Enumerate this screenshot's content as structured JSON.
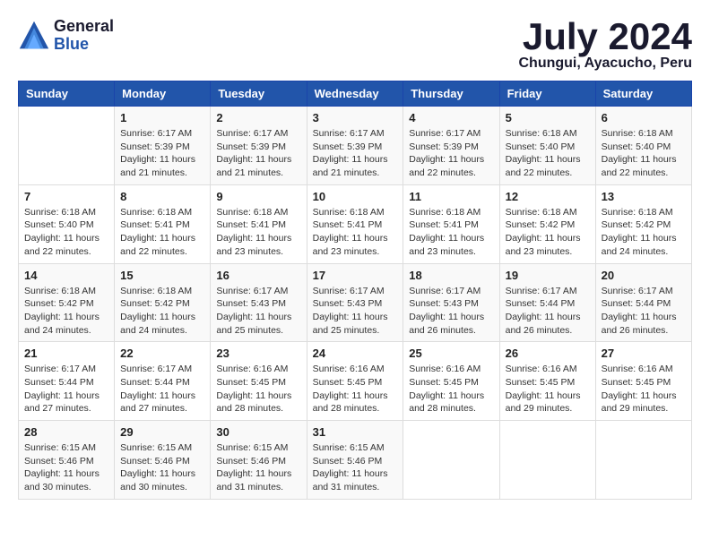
{
  "logo": {
    "general": "General",
    "blue": "Blue"
  },
  "title": {
    "month": "July 2024",
    "location": "Chungui, Ayacucho, Peru"
  },
  "headers": [
    "Sunday",
    "Monday",
    "Tuesday",
    "Wednesday",
    "Thursday",
    "Friday",
    "Saturday"
  ],
  "weeks": [
    [
      {
        "day": "",
        "sunrise": "",
        "sunset": "",
        "daylight": ""
      },
      {
        "day": "1",
        "sunrise": "6:17 AM",
        "sunset": "5:39 PM",
        "daylight": "11 hours and 21 minutes."
      },
      {
        "day": "2",
        "sunrise": "6:17 AM",
        "sunset": "5:39 PM",
        "daylight": "11 hours and 21 minutes."
      },
      {
        "day": "3",
        "sunrise": "6:17 AM",
        "sunset": "5:39 PM",
        "daylight": "11 hours and 21 minutes."
      },
      {
        "day": "4",
        "sunrise": "6:17 AM",
        "sunset": "5:39 PM",
        "daylight": "11 hours and 22 minutes."
      },
      {
        "day": "5",
        "sunrise": "6:18 AM",
        "sunset": "5:40 PM",
        "daylight": "11 hours and 22 minutes."
      },
      {
        "day": "6",
        "sunrise": "6:18 AM",
        "sunset": "5:40 PM",
        "daylight": "11 hours and 22 minutes."
      }
    ],
    [
      {
        "day": "7",
        "sunrise": "6:18 AM",
        "sunset": "5:40 PM",
        "daylight": "11 hours and 22 minutes."
      },
      {
        "day": "8",
        "sunrise": "6:18 AM",
        "sunset": "5:41 PM",
        "daylight": "11 hours and 22 minutes."
      },
      {
        "day": "9",
        "sunrise": "6:18 AM",
        "sunset": "5:41 PM",
        "daylight": "11 hours and 23 minutes."
      },
      {
        "day": "10",
        "sunrise": "6:18 AM",
        "sunset": "5:41 PM",
        "daylight": "11 hours and 23 minutes."
      },
      {
        "day": "11",
        "sunrise": "6:18 AM",
        "sunset": "5:41 PM",
        "daylight": "11 hours and 23 minutes."
      },
      {
        "day": "12",
        "sunrise": "6:18 AM",
        "sunset": "5:42 PM",
        "daylight": "11 hours and 23 minutes."
      },
      {
        "day": "13",
        "sunrise": "6:18 AM",
        "sunset": "5:42 PM",
        "daylight": "11 hours and 24 minutes."
      }
    ],
    [
      {
        "day": "14",
        "sunrise": "6:18 AM",
        "sunset": "5:42 PM",
        "daylight": "11 hours and 24 minutes."
      },
      {
        "day": "15",
        "sunrise": "6:18 AM",
        "sunset": "5:42 PM",
        "daylight": "11 hours and 24 minutes."
      },
      {
        "day": "16",
        "sunrise": "6:17 AM",
        "sunset": "5:43 PM",
        "daylight": "11 hours and 25 minutes."
      },
      {
        "day": "17",
        "sunrise": "6:17 AM",
        "sunset": "5:43 PM",
        "daylight": "11 hours and 25 minutes."
      },
      {
        "day": "18",
        "sunrise": "6:17 AM",
        "sunset": "5:43 PM",
        "daylight": "11 hours and 26 minutes."
      },
      {
        "day": "19",
        "sunrise": "6:17 AM",
        "sunset": "5:44 PM",
        "daylight": "11 hours and 26 minutes."
      },
      {
        "day": "20",
        "sunrise": "6:17 AM",
        "sunset": "5:44 PM",
        "daylight": "11 hours and 26 minutes."
      }
    ],
    [
      {
        "day": "21",
        "sunrise": "6:17 AM",
        "sunset": "5:44 PM",
        "daylight": "11 hours and 27 minutes."
      },
      {
        "day": "22",
        "sunrise": "6:17 AM",
        "sunset": "5:44 PM",
        "daylight": "11 hours and 27 minutes."
      },
      {
        "day": "23",
        "sunrise": "6:16 AM",
        "sunset": "5:45 PM",
        "daylight": "11 hours and 28 minutes."
      },
      {
        "day": "24",
        "sunrise": "6:16 AM",
        "sunset": "5:45 PM",
        "daylight": "11 hours and 28 minutes."
      },
      {
        "day": "25",
        "sunrise": "6:16 AM",
        "sunset": "5:45 PM",
        "daylight": "11 hours and 28 minutes."
      },
      {
        "day": "26",
        "sunrise": "6:16 AM",
        "sunset": "5:45 PM",
        "daylight": "11 hours and 29 minutes."
      },
      {
        "day": "27",
        "sunrise": "6:16 AM",
        "sunset": "5:45 PM",
        "daylight": "11 hours and 29 minutes."
      }
    ],
    [
      {
        "day": "28",
        "sunrise": "6:15 AM",
        "sunset": "5:46 PM",
        "daylight": "11 hours and 30 minutes."
      },
      {
        "day": "29",
        "sunrise": "6:15 AM",
        "sunset": "5:46 PM",
        "daylight": "11 hours and 30 minutes."
      },
      {
        "day": "30",
        "sunrise": "6:15 AM",
        "sunset": "5:46 PM",
        "daylight": "11 hours and 31 minutes."
      },
      {
        "day": "31",
        "sunrise": "6:15 AM",
        "sunset": "5:46 PM",
        "daylight": "11 hours and 31 minutes."
      },
      {
        "day": "",
        "sunrise": "",
        "sunset": "",
        "daylight": ""
      },
      {
        "day": "",
        "sunrise": "",
        "sunset": "",
        "daylight": ""
      },
      {
        "day": "",
        "sunrise": "",
        "sunset": "",
        "daylight": ""
      }
    ]
  ]
}
